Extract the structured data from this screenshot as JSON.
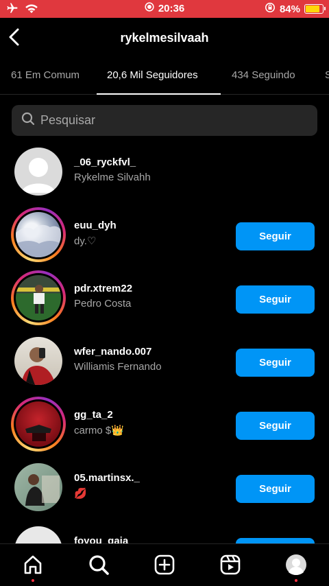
{
  "status_bar": {
    "time": "20:36",
    "battery_percent": "84%",
    "battery_level": 0.84,
    "bg_color": "#e0383e",
    "icons": [
      "airplane-icon",
      "wifi-icon",
      "screen-record-icon",
      "rotation-lock-icon",
      "battery-icon"
    ]
  },
  "header": {
    "title": "rykelmesilvaah"
  },
  "tabs": [
    {
      "label": "61 Em Comum",
      "active": false
    },
    {
      "label": "20,6 Mil Seguidores",
      "active": true
    },
    {
      "label": "434 Seguindo",
      "active": false
    },
    {
      "label": "S",
      "active": false
    }
  ],
  "search": {
    "placeholder": "Pesquisar"
  },
  "follow_label": "Seguir",
  "users": [
    {
      "username": "_06_ryckfvl_",
      "fullname": "Rykelme Silvahh",
      "story_ring": false,
      "follow_button": false
    },
    {
      "username": "euu_dyh",
      "fullname": "dy.♡",
      "story_ring": true,
      "follow_button": true
    },
    {
      "username": "pdr.xtrem22",
      "fullname": "Pedro Costa",
      "story_ring": true,
      "follow_button": true
    },
    {
      "username": "wfer_nando.007",
      "fullname": "Williamis Fernando",
      "story_ring": false,
      "follow_button": true
    },
    {
      "username": "gg_ta_2",
      "fullname": "carmo $👑",
      "story_ring": true,
      "follow_button": true
    },
    {
      "username": "05.martinsx._",
      "fullname": "💋",
      "story_ring": false,
      "follow_button": true
    },
    {
      "username": "foyou_gaia",
      "fullname": "",
      "story_ring": false,
      "follow_button": true
    }
  ],
  "bottom_nav": [
    "home-icon",
    "search-icon",
    "create-icon",
    "reels-icon",
    "profile-icon"
  ],
  "colors": {
    "accent": "#0095f6",
    "background": "#000000",
    "secondary_text": "#a8a8a8",
    "notification_dot": "#ff3040"
  }
}
